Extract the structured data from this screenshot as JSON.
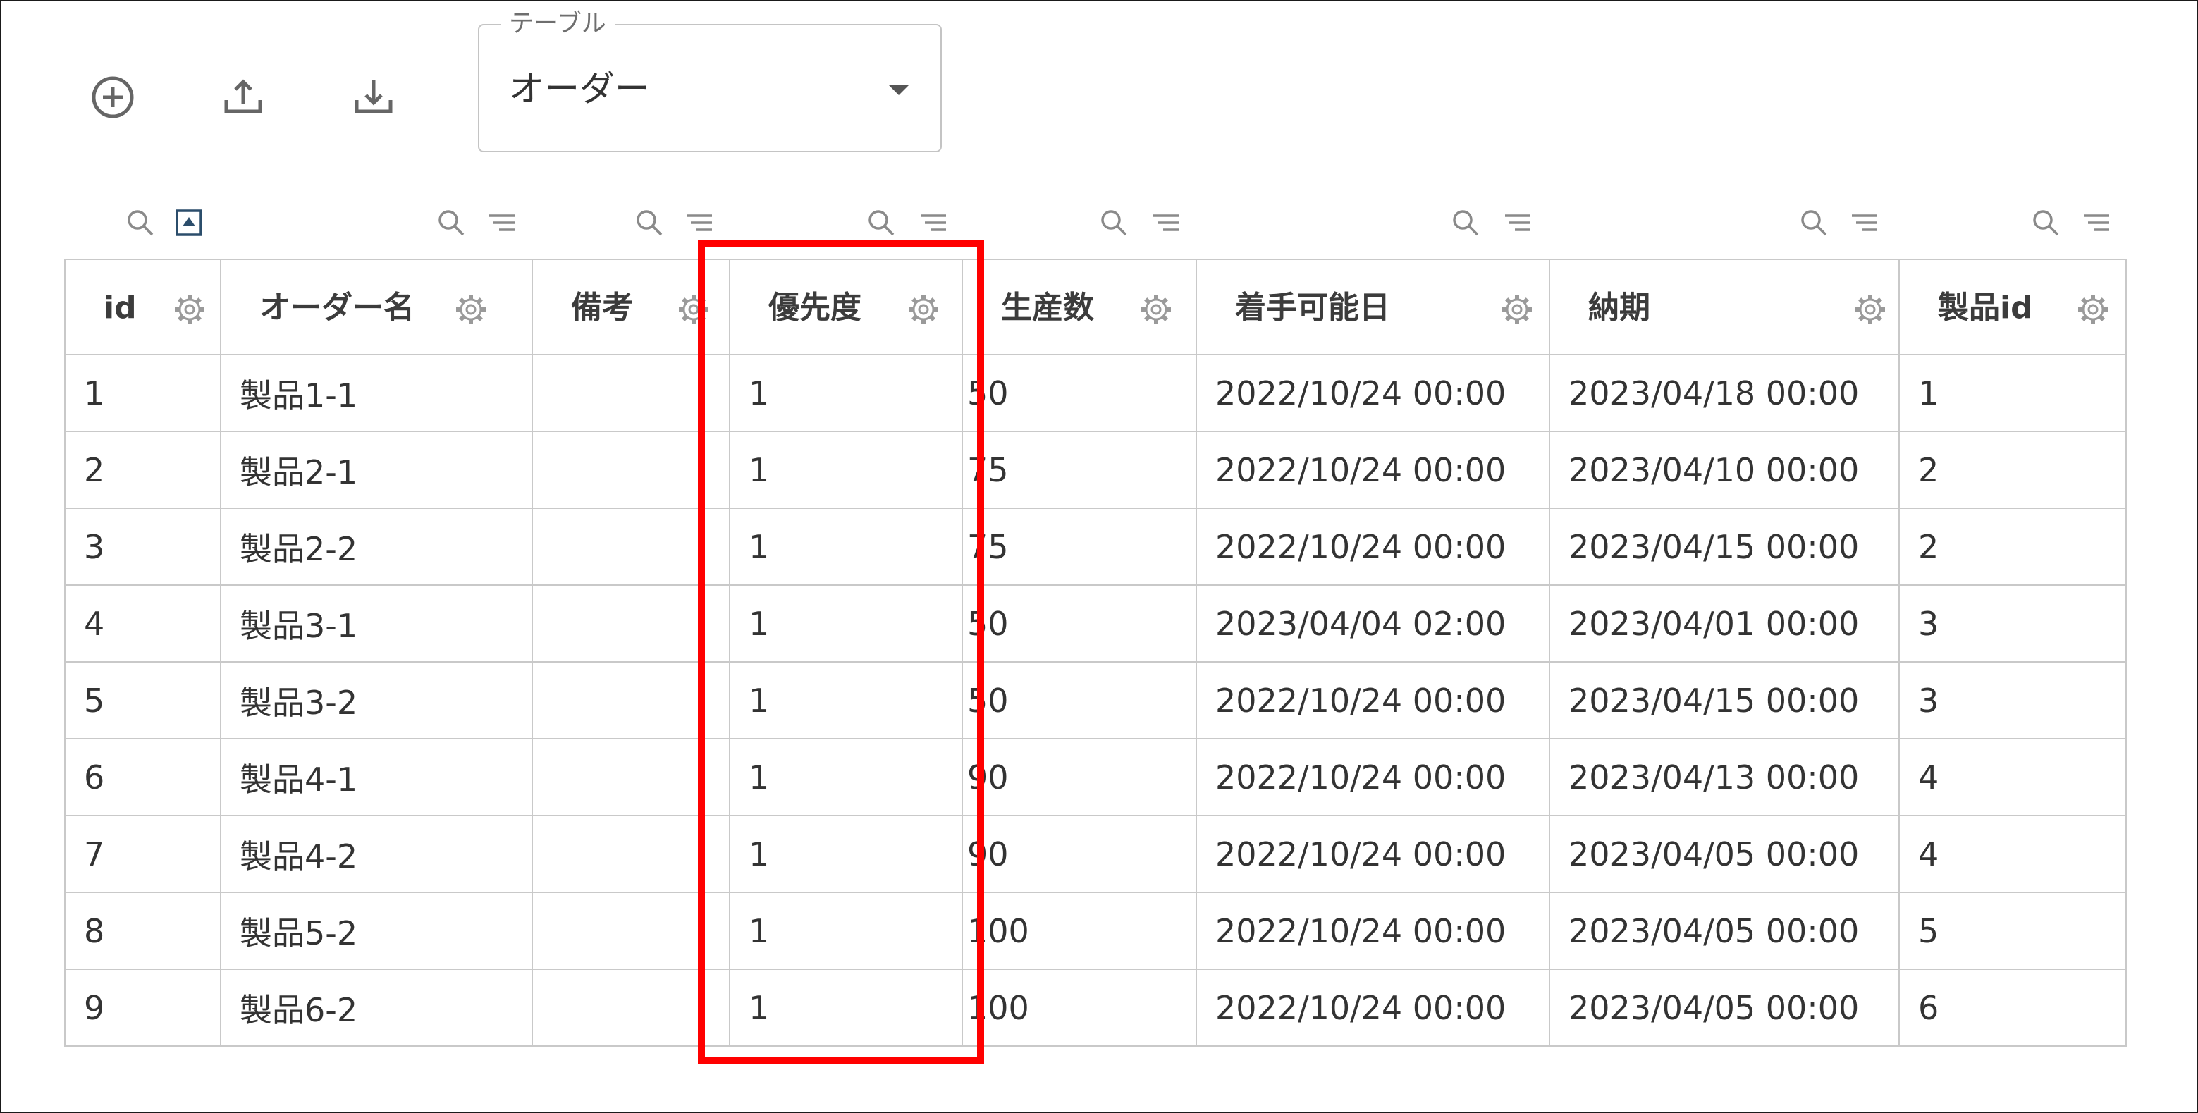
{
  "colors": {
    "highlight": "#ff0000",
    "border": "#c9c9c9",
    "icon": "#757575",
    "text": "#333333"
  },
  "toolbar": {
    "add_icon": "plus-circle-icon",
    "upload_icon": "upload-icon",
    "download_icon": "download-icon"
  },
  "table_select": {
    "legend": "テーブル",
    "value": "オーダー"
  },
  "columns": [
    {
      "label": "id"
    },
    {
      "label": "オーダー名"
    },
    {
      "label": "備考"
    },
    {
      "label": "優先度"
    },
    {
      "label": "生産数"
    },
    {
      "label": "着手可能日"
    },
    {
      "label": "納期"
    },
    {
      "label": "製品id"
    }
  ],
  "rows": [
    [
      "1",
      "製品1-1",
      "",
      "1",
      "50",
      "2022/10/24 00:00",
      "2023/04/18 00:00",
      "1"
    ],
    [
      "2",
      "製品2-1",
      "",
      "1",
      "75",
      "2022/10/24 00:00",
      "2023/04/10 00:00",
      "2"
    ],
    [
      "3",
      "製品2-2",
      "",
      "1",
      "75",
      "2022/10/24 00:00",
      "2023/04/15 00:00",
      "2"
    ],
    [
      "4",
      "製品3-1",
      "",
      "1",
      "50",
      "2023/04/04 02:00",
      "2023/04/01 00:00",
      "3"
    ],
    [
      "5",
      "製品3-2",
      "",
      "1",
      "50",
      "2022/10/24 00:00",
      "2023/04/15 00:00",
      "3"
    ],
    [
      "6",
      "製品4-1",
      "",
      "1",
      "90",
      "2022/10/24 00:00",
      "2023/04/13 00:00",
      "4"
    ],
    [
      "7",
      "製品4-2",
      "",
      "1",
      "90",
      "2022/10/24 00:00",
      "2023/04/05 00:00",
      "4"
    ],
    [
      "8",
      "製品5-2",
      "",
      "1",
      "100",
      "2022/10/24 00:00",
      "2023/04/05 00:00",
      "5"
    ],
    [
      "9",
      "製品6-2",
      "",
      "1",
      "100",
      "2022/10/24 00:00",
      "2023/04/05 00:00",
      "6"
    ]
  ]
}
